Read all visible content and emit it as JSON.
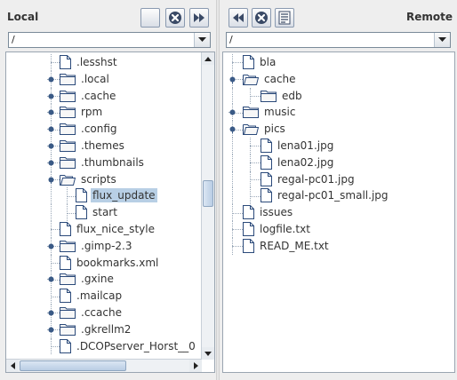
{
  "local": {
    "title": "Local",
    "path": "/",
    "items": [
      {
        "label": ".lesshst",
        "type": "file",
        "expander": "none",
        "indent": 3
      },
      {
        "label": ".local",
        "type": "folder",
        "expander": "collapsed",
        "indent": 3
      },
      {
        "label": ".cache",
        "type": "folder",
        "expander": "collapsed",
        "indent": 3
      },
      {
        "label": "rpm",
        "type": "folder",
        "expander": "collapsed",
        "indent": 3
      },
      {
        "label": ".config",
        "type": "folder",
        "expander": "collapsed",
        "indent": 3
      },
      {
        "label": ".themes",
        "type": "folder",
        "expander": "collapsed",
        "indent": 3
      },
      {
        "label": ".thumbnails",
        "type": "folder",
        "expander": "collapsed",
        "indent": 3
      },
      {
        "label": "scripts",
        "type": "folder-open",
        "expander": "expanded",
        "indent": 3
      },
      {
        "label": "flux_update",
        "type": "file",
        "expander": "none",
        "indent": 4,
        "selected": true
      },
      {
        "label": "start",
        "type": "file",
        "expander": "none",
        "indent": 4
      },
      {
        "label": "flux_nice_style",
        "type": "file",
        "expander": "none",
        "indent": 3
      },
      {
        "label": ".gimp-2.3",
        "type": "folder",
        "expander": "collapsed",
        "indent": 3
      },
      {
        "label": "bookmarks.xml",
        "type": "file",
        "expander": "none",
        "indent": 3
      },
      {
        "label": ".gxine",
        "type": "folder",
        "expander": "collapsed",
        "indent": 3
      },
      {
        "label": ".mailcap",
        "type": "file",
        "expander": "none",
        "indent": 3
      },
      {
        "label": ".ccache",
        "type": "folder",
        "expander": "collapsed",
        "indent": 3
      },
      {
        "label": ".gkrellm2",
        "type": "folder",
        "expander": "collapsed",
        "indent": 3
      },
      {
        "label": ".DCOPserver_Horst__0",
        "type": "file",
        "expander": "none",
        "indent": 3
      }
    ],
    "vscroll_position": 0.45
  },
  "remote": {
    "title": "Remote",
    "path": "/",
    "items": [
      {
        "label": "bla",
        "type": "file",
        "expander": "none",
        "indent": 1
      },
      {
        "label": "cache",
        "type": "folder-open",
        "expander": "expanded",
        "indent": 1
      },
      {
        "label": "edb",
        "type": "folder",
        "expander": "none",
        "indent": 2
      },
      {
        "label": "music",
        "type": "folder",
        "expander": "collapsed",
        "indent": 1
      },
      {
        "label": "pics",
        "type": "folder-open",
        "expander": "expanded",
        "indent": 1
      },
      {
        "label": "lena01.jpg",
        "type": "file",
        "expander": "none",
        "indent": 2
      },
      {
        "label": "lena02.jpg",
        "type": "file",
        "expander": "none",
        "indent": 2
      },
      {
        "label": "regal-pc01.jpg",
        "type": "file",
        "expander": "none",
        "indent": 2
      },
      {
        "label": "regal-pc01_small.jpg",
        "type": "file",
        "expander": "none",
        "indent": 2
      },
      {
        "label": "issues",
        "type": "file",
        "expander": "none",
        "indent": 1
      },
      {
        "label": "logfile.txt",
        "type": "file",
        "expander": "none",
        "indent": 1
      },
      {
        "label": "READ_ME.txt",
        "type": "file",
        "expander": "none",
        "indent": 1
      }
    ]
  },
  "icons": {
    "local_blank": "blank-icon",
    "local_stop": "stop-icon",
    "local_upload": "upload-icon",
    "remote_download": "download-icon",
    "remote_stop": "stop-icon",
    "remote_details": "details-icon"
  },
  "colors": {
    "selection": "#b8cfe5",
    "folder": "#f7f7f7",
    "button_dark": "#3a4a66"
  }
}
